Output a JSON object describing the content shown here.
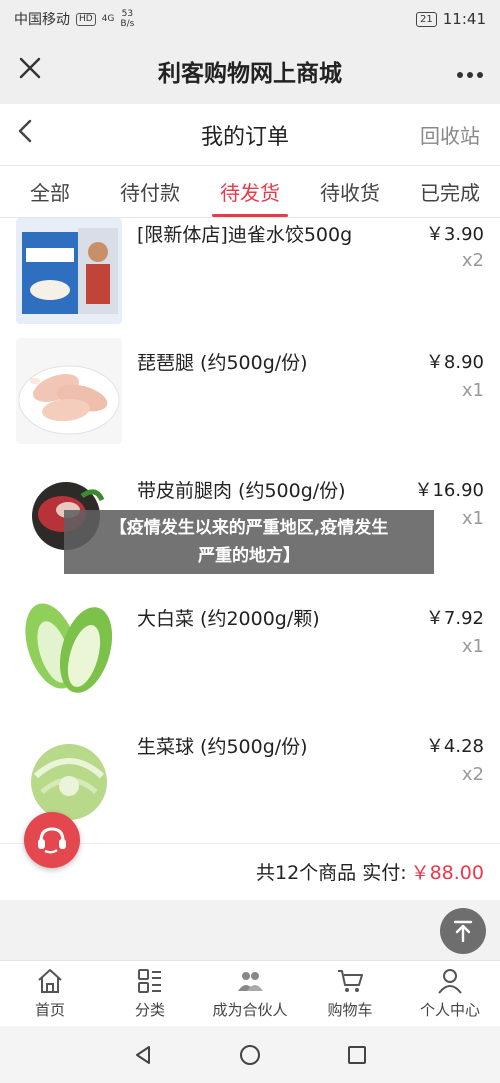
{
  "status_bar": {
    "carrier": "中国移动",
    "hd": "HD",
    "signal": "4G",
    "speed_value": "53",
    "speed_unit": "B/s",
    "battery": "21",
    "time": "11:41"
  },
  "app_bar": {
    "close_icon": "close-icon",
    "title": "利客购物网上商城",
    "more_icon": "more-icon"
  },
  "page_header": {
    "back_icon": "back-icon",
    "title": "我的订单",
    "recycle_label": "回收站"
  },
  "tabs": [
    {
      "label": "全部",
      "active": false
    },
    {
      "label": "待付款",
      "active": false
    },
    {
      "label": "待发货",
      "active": true
    },
    {
      "label": "待收货",
      "active": false
    },
    {
      "label": "已完成",
      "active": false
    }
  ],
  "order_items": [
    {
      "name": "[限新体店]迪雀水饺500g",
      "price": "￥3.90",
      "qty": "x2"
    },
    {
      "name": "琵琶腿 (约500g/份)",
      "price": "￥8.90",
      "qty": "x1"
    },
    {
      "name": "带皮前腿肉 (约500g/份)",
      "price": "￥16.90",
      "qty": "x1"
    },
    {
      "name": "大白菜 (约2000g/颗)",
      "price": "￥7.92",
      "qty": "x1"
    },
    {
      "name": "生菜球 (约500g/份)",
      "price": "￥4.28",
      "qty": "x2"
    }
  ],
  "summary": {
    "count_text": "共12个商品",
    "paid_label": "实付:",
    "total": "￥88.00"
  },
  "overlay_banner": {
    "line1": "【疫情发生以来的严重地区,疫情发生",
    "line2": "严重的地方】"
  },
  "bottom_nav": [
    {
      "label": "首页",
      "icon": "home-icon"
    },
    {
      "label": "分类",
      "icon": "category-icon"
    },
    {
      "label": "成为合伙人",
      "icon": "partner-icon"
    },
    {
      "label": "购物车",
      "icon": "cart-icon"
    },
    {
      "label": "个人中心",
      "icon": "user-icon"
    }
  ],
  "colors": {
    "accent": "#e83a4a",
    "fab_service": "#e5474e",
    "fab_top": "#6e6e6e"
  }
}
